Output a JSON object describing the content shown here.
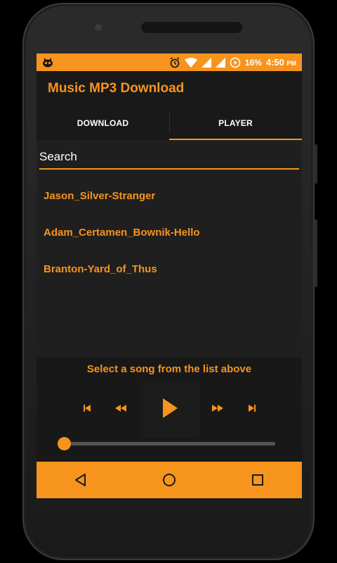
{
  "status_bar": {
    "battery": "16%",
    "time": "4:50",
    "ampm": "PM",
    "icons": [
      "notification-app-icon",
      "alarm-icon",
      "wifi-icon",
      "signal-icon",
      "signal-icon",
      "data-saver-icon"
    ]
  },
  "app": {
    "title": "Music MP3 Download"
  },
  "tabs": [
    {
      "label": "DOWNLOAD",
      "selected": false
    },
    {
      "label": "PLAYER",
      "selected": true
    }
  ],
  "search": {
    "placeholder": "Search",
    "value": ""
  },
  "songs": [
    {
      "title": "Jason_Silver-Stranger"
    },
    {
      "title": "Adam_Certamen_Bownik-Hello"
    },
    {
      "title": "Branton-Yard_of_Thus"
    }
  ],
  "player": {
    "hint": "Select a song from the list above",
    "progress": 0,
    "controls": [
      "skip-previous-icon",
      "rewind-icon",
      "play-icon",
      "fast-forward-icon",
      "skip-next-icon"
    ]
  },
  "nav": {
    "icons": [
      "back-icon",
      "home-icon",
      "recents-icon"
    ]
  },
  "colors": {
    "accent": "#f7941d",
    "background": "#1f1f1f",
    "bar": "#191919"
  }
}
